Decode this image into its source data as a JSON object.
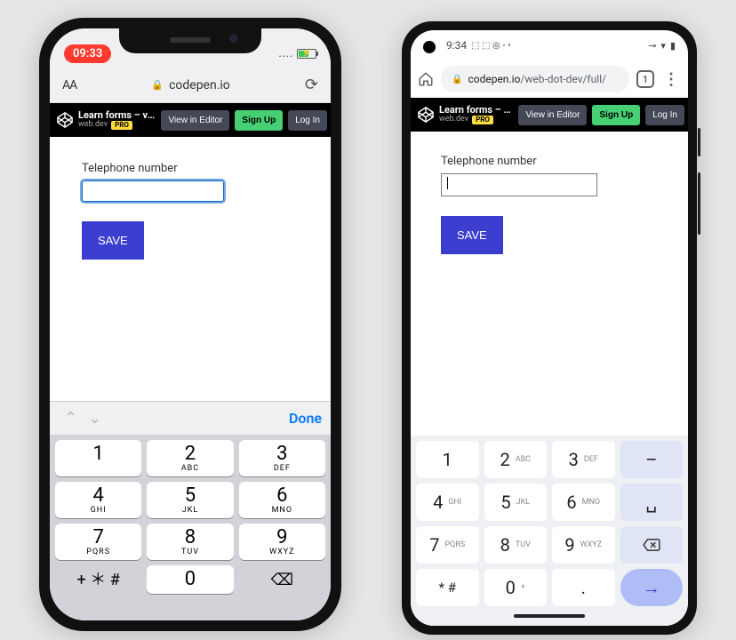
{
  "ios": {
    "status": {
      "time": "09:33",
      "signal_dots": "....",
      "lightning": "⚡"
    },
    "safari": {
      "textsize": "AA",
      "lock": "🔒",
      "host": "codepen.io",
      "reload": "⟳"
    },
    "codepen": {
      "title": "Learn forms – virt…",
      "author": "web.dev",
      "pro": "PRO",
      "view": "View in Editor",
      "signup": "Sign Up",
      "login": "Log In"
    },
    "page": {
      "label": "Telephone number",
      "save": "SAVE"
    },
    "keyboard_accessory": {
      "up": "⌃",
      "down": "⌄",
      "done": "Done"
    },
    "keypad": {
      "r1c1": {
        "d": "1",
        "l": ""
      },
      "r1c2": {
        "d": "2",
        "l": "ABC"
      },
      "r1c3": {
        "d": "3",
        "l": "DEF"
      },
      "r2c1": {
        "d": "4",
        "l": "GHI"
      },
      "r2c2": {
        "d": "5",
        "l": "JKL"
      },
      "r2c3": {
        "d": "6",
        "l": "MNO"
      },
      "r3c1": {
        "d": "7",
        "l": "PQRS"
      },
      "r3c2": {
        "d": "8",
        "l": "TUV"
      },
      "r3c3": {
        "d": "9",
        "l": "WXYZ"
      },
      "r4c1": "+ ＊ #",
      "r4c2": {
        "d": "0",
        "l": ""
      },
      "r4c3": "⌫"
    }
  },
  "android": {
    "status": {
      "time": "9:34",
      "left_icons": "⬚ ⬚ ◎ ◦ •",
      "vpn": "⊸",
      "wifi": "▾",
      "battery": "▮"
    },
    "chrome": {
      "lock": "🔒",
      "host": "codepen.io",
      "path": "/web-dot-dev/full/",
      "tab_count": "1",
      "menu": "⋮"
    },
    "codepen": {
      "title": "Learn forms – virt…",
      "author": "web.dev",
      "pro": "PRO",
      "view": "View in Editor",
      "signup": "Sign Up",
      "login": "Log In"
    },
    "page": {
      "label": "Telephone number",
      "save": "SAVE"
    },
    "keypad": {
      "r1c1": {
        "d": "1",
        "l": ""
      },
      "r1c2": {
        "d": "2",
        "l": "ABC"
      },
      "r1c3": {
        "d": "3",
        "l": "DEF"
      },
      "r1c4": "–",
      "r2c1": {
        "d": "4",
        "l": "GHI"
      },
      "r2c2": {
        "d": "5",
        "l": "JKL"
      },
      "r2c3": {
        "d": "6",
        "l": "MNO"
      },
      "r2c4": "␣",
      "r3c1": {
        "d": "7",
        "l": "PQRS"
      },
      "r3c2": {
        "d": "8",
        "l": "TUV"
      },
      "r3c3": {
        "d": "9",
        "l": "WXYZ"
      },
      "r3c4": "⌫",
      "r4c1": "* #",
      "r4c2": {
        "d": "0",
        "l": "+"
      },
      "r4c3": ".",
      "r4c4": "→"
    }
  }
}
